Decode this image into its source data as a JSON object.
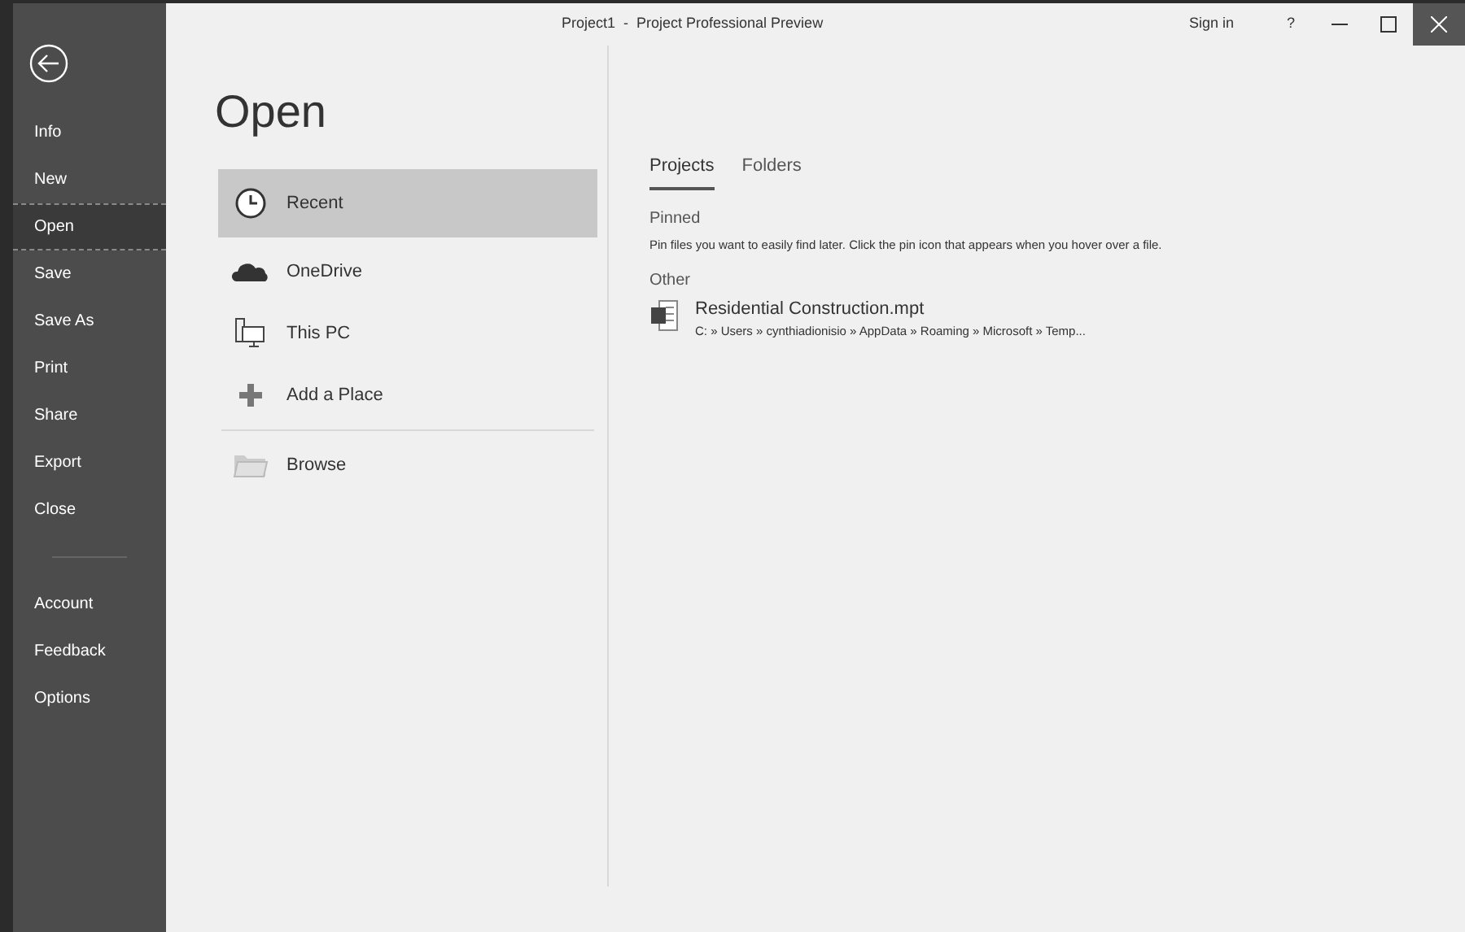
{
  "window": {
    "title": "Project1  -  Project Professional Preview",
    "sign_in": "Sign in",
    "help": "?"
  },
  "sidebar": {
    "items": [
      {
        "label": "Info",
        "selected": false
      },
      {
        "label": "New",
        "selected": false
      },
      {
        "label": "Open",
        "selected": true
      },
      {
        "label": "Save",
        "selected": false
      },
      {
        "label": "Save As",
        "selected": false
      },
      {
        "label": "Print",
        "selected": false
      },
      {
        "label": "Share",
        "selected": false
      },
      {
        "label": "Export",
        "selected": false
      },
      {
        "label": "Close",
        "selected": false
      }
    ],
    "bottom_items": [
      {
        "label": "Account",
        "selected": false
      },
      {
        "label": "Feedback",
        "selected": false
      },
      {
        "label": "Options",
        "selected": false
      }
    ]
  },
  "heading": "Open",
  "places": [
    {
      "kind": "recent",
      "label": "Recent",
      "selected": true
    },
    {
      "kind": "onedrive",
      "label": "OneDrive",
      "selected": false
    },
    {
      "kind": "pc",
      "label": "This PC",
      "selected": false
    },
    {
      "kind": "add",
      "label": "Add a Place",
      "selected": false
    }
  ],
  "browse": {
    "label": "Browse"
  },
  "tabs": [
    {
      "label": "Projects",
      "selected": true
    },
    {
      "label": "Folders",
      "selected": false
    }
  ],
  "pinned": {
    "title": "Pinned",
    "hint": "Pin files you want to easily find later. Click the pin icon that appears when you hover over a file."
  },
  "other": {
    "title": "Other",
    "files": [
      {
        "name": "Residential Construction.mpt",
        "path": "C: » Users » cynthiadionisio » AppData » Roaming » Microsoft » Temp..."
      }
    ]
  }
}
